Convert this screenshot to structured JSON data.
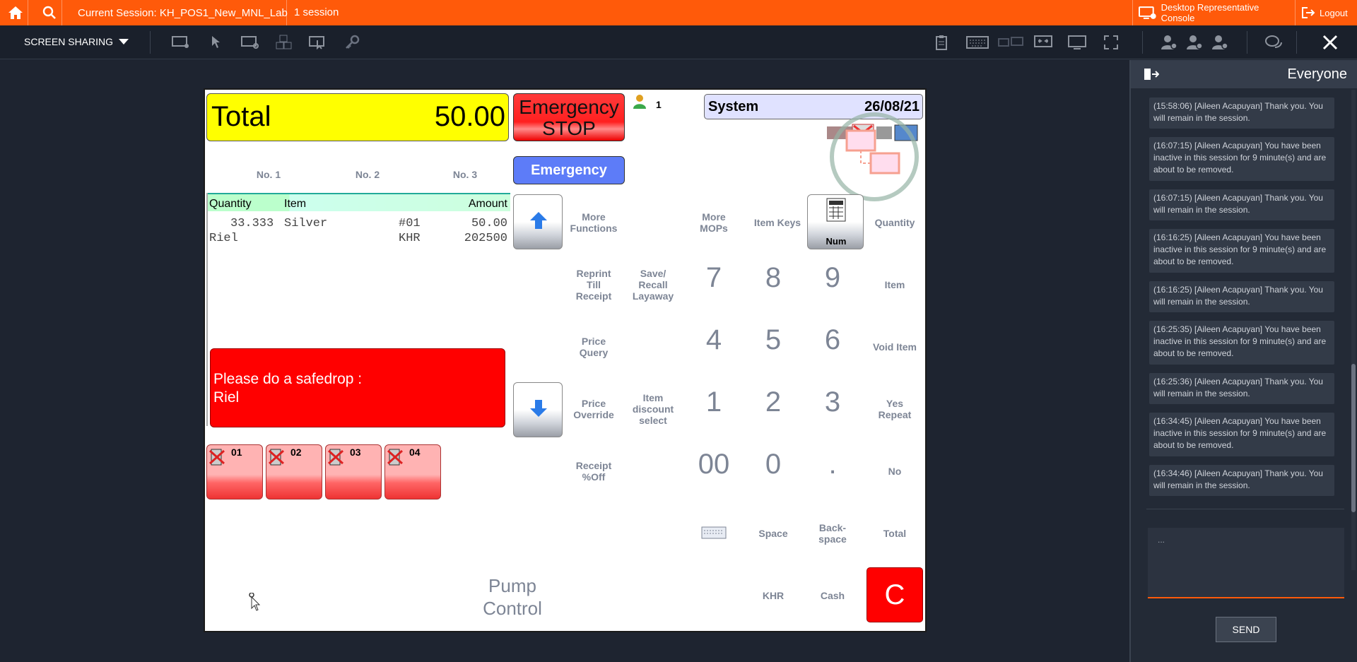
{
  "topbar": {
    "session_label": "Current Session: KH_POS1_New_MNL_Lab",
    "session_count": "1 session",
    "console_label": "Desktop Representative Console",
    "logout_label": "Logout"
  },
  "toolbar": {
    "screen_sharing_label": "SCREEN SHARING"
  },
  "pos": {
    "total_label": "Total",
    "total_value": "50.00",
    "emergency_stop_label": "Emergency\nSTOP",
    "emergency_label": "Emergency",
    "user_count": "1",
    "system_label": "System",
    "date": "26/08/21",
    "tabs": [
      "No. 1",
      "No. 2",
      "No. 3"
    ],
    "grid_headers": {
      "quantity": "Quantity",
      "item": "Item",
      "amount": "Amount"
    },
    "lines": [
      {
        "qty": "33.333",
        "item": "Silver",
        "code": "#01",
        "amount": "50.00"
      },
      {
        "qty": "Riel",
        "item": "",
        "code": "KHR",
        "amount": "202500"
      }
    ],
    "alert_line1": "Please do a safedrop :",
    "alert_line2": "Riel",
    "pumps": [
      "01",
      "02",
      "03",
      "04"
    ],
    "pump_control_label": "Pump\nControl",
    "num_key_label": "Num",
    "labels": {
      "more_functions": "More\nFunctions",
      "more_mops": "More\nMOPs",
      "item_keys": "Item Keys",
      "quantity": "Quantity",
      "reprint": "Reprint\nTill\nReceipt",
      "save_recall": "Save/\nRecall\nLayaway",
      "item": "Item",
      "price_query": "Price\nQuery",
      "void_item": "Void Item",
      "price_override": "Price\nOverride",
      "item_discount": "Item\ndiscount\nselect",
      "yes_repeat": "Yes\nRepeat",
      "receipt_off": "Receipt\n%Off",
      "no": "No",
      "space": "Space",
      "backspace": "Back-\nspace",
      "total": "Total",
      "khr": "KHR",
      "cash": "Cash",
      "clear": "C"
    },
    "keys": {
      "k7": "7",
      "k8": "8",
      "k9": "9",
      "k4": "4",
      "k5": "5",
      "k6": "6",
      "k1": "1",
      "k2": "2",
      "k3": "3",
      "k00": "00",
      "k0": "0",
      "kdot": "."
    }
  },
  "sidebar": {
    "title": "Everyone",
    "messages": [
      "(15:58:06) [Aileen Acapuyan] Thank you.  You will remain in the session.",
      "(16:07:15) [Aileen Acapuyan] You have been inactive in this session for 9 minute(s) and are about to be removed.",
      "(16:07:15) [Aileen Acapuyan] Thank you.  You will remain in the session.",
      "(16:16:25) [Aileen Acapuyan] You have been inactive in this session for 9 minute(s) and are about to be removed.",
      "(16:16:25) [Aileen Acapuyan] Thank you.  You will remain in the session.",
      "(16:25:35) [Aileen Acapuyan] You have been inactive in this session for 9 minute(s) and are about to be removed.",
      "(16:25:36) [Aileen Acapuyan] Thank you.  You will remain in the session.",
      "(16:34:45) [Aileen Acapuyan] You have been inactive in this session for 9 minute(s) and are about to be removed.",
      "(16:34:46) [Aileen Acapuyan] Thank you.  You will remain in the session."
    ],
    "input_value": "...",
    "send_label": "SEND"
  }
}
